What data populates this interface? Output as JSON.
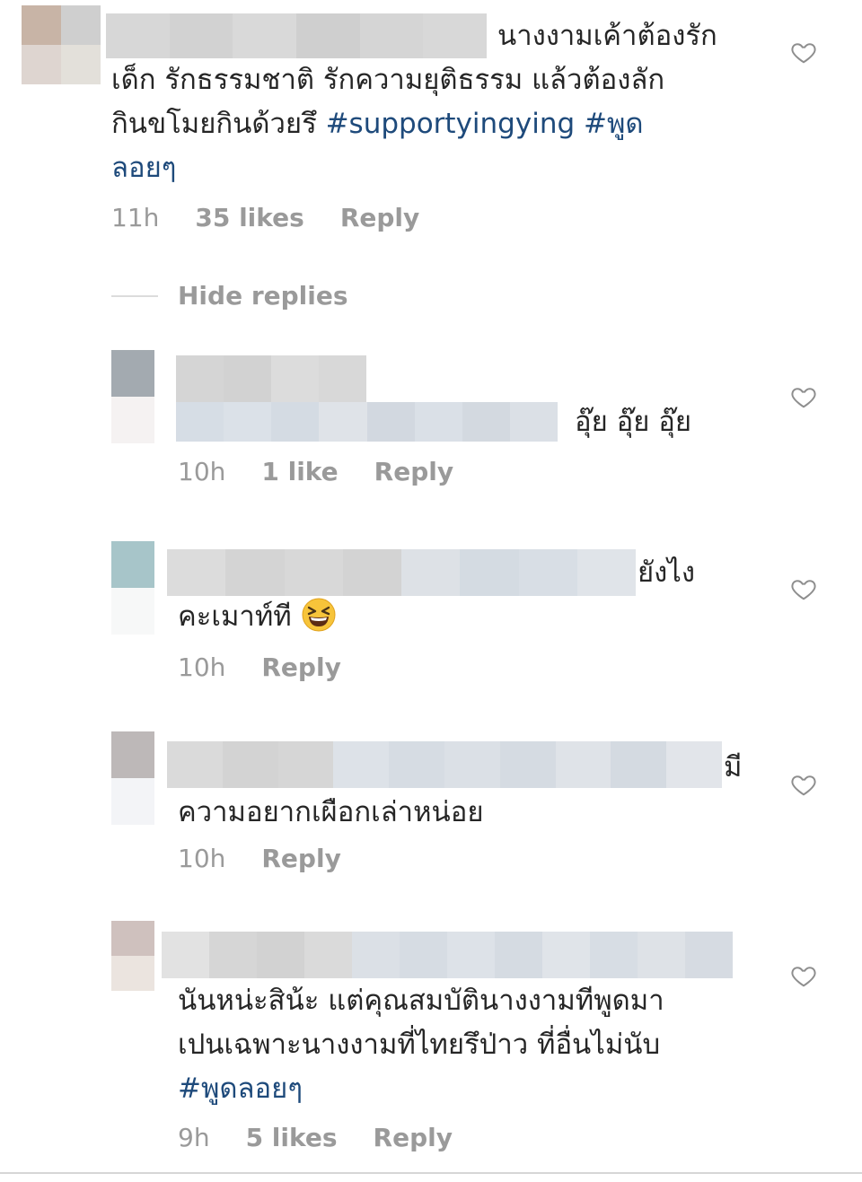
{
  "comments": [
    {
      "line1": "นางงามเค้าต้องรัก",
      "line2": "เด็ก รักธรรมชาติ รักความยุติธรรม แล้วต้องลัก",
      "line3_text": "กินขโมยกินด้วยรึ ",
      "line3_tag1": "#supportyingying",
      "line3_tag2": " #พูด",
      "line4_tag": "ลอยๆ",
      "time": "11h",
      "likes": "35 likes",
      "reply": "Reply"
    },
    {
      "line1": "อุ๊ย อุ๊ย อุ๊ย",
      "time": "10h",
      "likes": "1 like",
      "reply": "Reply"
    },
    {
      "line1": "ยังไง",
      "line2": "คะเมาท์ที",
      "time": "10h",
      "reply": "Reply"
    },
    {
      "line1": "มี",
      "line2": "ความอยากเผือกเล่าหน่อย",
      "time": "10h",
      "reply": "Reply"
    },
    {
      "line1": "นันหน่ะสิน้ะ แต่คุณสมบัตินางงามทีพูดมา",
      "line2": "เปนเฉพาะนางงามที่ไทยรึป่าว ที่อื่นไม่นับ",
      "line3_tag": "#พูดลอยๆ",
      "time": "9h",
      "likes": "5 likes",
      "reply": "Reply"
    }
  ],
  "hide_replies": "Hide replies",
  "icons": {
    "like": "heart-outline-icon",
    "emoji": "grinning-squinting-face-emoji"
  },
  "colors": {
    "hashtag": "#1e4a7b",
    "meta": "#9a9a9a",
    "text": "#262626"
  }
}
